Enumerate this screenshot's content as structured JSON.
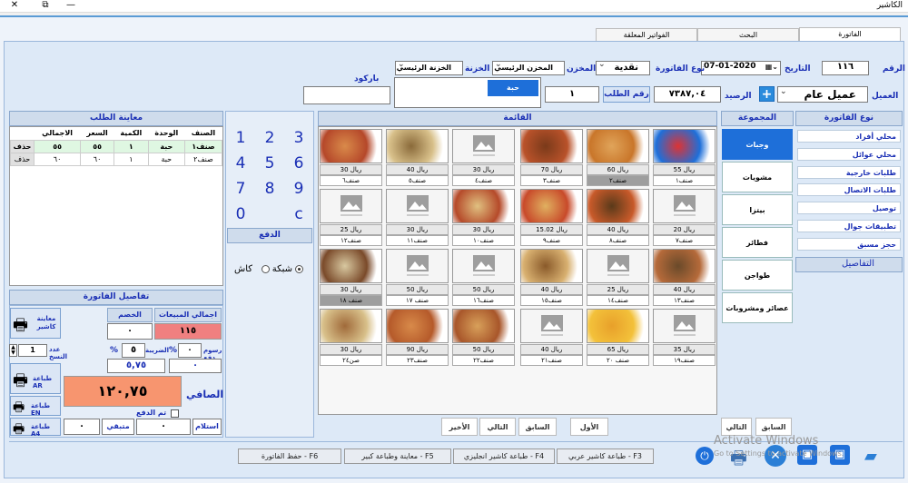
{
  "window": {
    "title": "الكاشير"
  },
  "tabs": [
    "الفاتورة",
    "البحث",
    "الفواتير المعلقة"
  ],
  "header": {
    "num_label": "الرقم",
    "num_value": "١١٦",
    "date_label": "التاريخ",
    "date_value": "07-01-2020",
    "invoice_type_label": "نوع الفاتورة",
    "invoice_type_value": "نقدية",
    "store_label": "المخزن",
    "store_value": "المخزن الرئيسي",
    "treasury_label": "الخزنة",
    "treasury_value": "الخزنة الرئيسي",
    "customer_label": "العميل",
    "customer_value": "عميل عام",
    "balance_label": "الرصيد",
    "balance_value": "٧٣٨٧,٠٤",
    "order_num_label": "رقم الطلب",
    "order_num_value": "١",
    "barcode_label": "باركود",
    "unit_popup_option": "حبة"
  },
  "invoice_types": {
    "header": "نوع الفاتورة",
    "items": [
      "محلي أفراد",
      "محلي عوائل",
      "طلبات خارجية",
      "طلبات الاتصال",
      "توصيل",
      "تطبيقات جوال",
      "حجز مسبق"
    ],
    "details_btn": "التفاصيل"
  },
  "groups": {
    "header": "المجموعة",
    "items": [
      "وجبات",
      "مشويات",
      "بيتزا",
      "فطائر",
      "طواجن",
      "عصائر ومشروبات"
    ],
    "prev": "السابق",
    "next": "التالي"
  },
  "menu": {
    "header": "القائمة",
    "items": [
      {
        "price": "ريال 55",
        "name": "صنف١"
      },
      {
        "price": "ريال 60",
        "name": "صنف٢"
      },
      {
        "price": "ريال 70",
        "name": "صنف٣"
      },
      {
        "price": "ريال 30",
        "name": "صنف٤"
      },
      {
        "price": "ريال 40",
        "name": "صنف٥"
      },
      {
        "price": "ريال 30",
        "name": "صنف٦"
      },
      {
        "price": "ريال 20",
        "name": "صنف٧"
      },
      {
        "price": "ريال 40",
        "name": "صنف٨"
      },
      {
        "price": "ريال 15.02",
        "name": "صنف٩"
      },
      {
        "price": "ريال 30",
        "name": "صنف١٠"
      },
      {
        "price": "ريال 30",
        "name": "صنف١١"
      },
      {
        "price": "ريال 25",
        "name": "صنف١٢"
      },
      {
        "price": "ريال 40",
        "name": "صنف١٣"
      },
      {
        "price": "ريال 25",
        "name": "صنف١٤"
      },
      {
        "price": "ريال 40",
        "name": "صنف١٥"
      },
      {
        "price": "ريال 50",
        "name": "صنف١٦"
      },
      {
        "price": "ريال 50",
        "name": "صنف ١٧"
      },
      {
        "price": "ريال 30",
        "name": "صنف ١٨"
      },
      {
        "price": "ريال 35",
        "name": "صنف١٩"
      },
      {
        "price": "ريال 65",
        "name": "صنف ٢٠"
      },
      {
        "price": "ريال 40",
        "name": "صنف٢١"
      },
      {
        "price": "ريال 50",
        "name": "صنف٢٢"
      },
      {
        "price": "ريال 90",
        "name": "صنف٢٣"
      },
      {
        "price": "ريال 30",
        "name": "صن٢٤"
      }
    ],
    "nav": [
      "الأول",
      "السابق",
      "التالي",
      "الأخير"
    ]
  },
  "keypad": {
    "keys": [
      "1",
      "2",
      "3",
      "4",
      "5",
      "6",
      "7",
      "8",
      "9",
      "0",
      "c"
    ],
    "pay_label": "الدفع",
    "cash": "كاش",
    "network": "شبكة"
  },
  "order_preview": {
    "header": "معاينة الطلب",
    "columns": [
      "الصنف",
      "الوحدة",
      "الكمية",
      "السعر",
      "الاجمالي"
    ],
    "rows": [
      {
        "item": "صنف١",
        "unit": "حبة",
        "qty": "١",
        "price": "٥٥",
        "total": "٥٥",
        "del": "حذف"
      },
      {
        "item": "صنف٢",
        "unit": "حبة",
        "qty": "١",
        "price": "٦٠",
        "total": "٦٠",
        "del": "حذف"
      }
    ]
  },
  "invoice_details": {
    "header": "تفاصيل الفاتورة",
    "sales_total_label": "اجمالي المبيعات",
    "sales_total_value": "١١٥",
    "discount_label": "الخصم",
    "discount_value": "٠",
    "service_fee_label": "رسوم دفع",
    "service_fee_value": "٠",
    "tax_label": "الضريبة",
    "tax_pct": "٥",
    "tax_value": "٥,٧٥",
    "fee_value2": "٠",
    "pct": "%",
    "net_label": "الصافي",
    "net_value": "١٢٠,٧٥",
    "paid_label": "تم الدفع",
    "received_label": "استلام",
    "received_value": "٠",
    "remaining_label": "متبقي",
    "remaining_value": "٠",
    "copies_label": "عدد النسخ",
    "copies_value": "1"
  },
  "side_buttons": {
    "preview": "معاينة كاشير",
    "print_ar": "طباعة AR",
    "print_en": "طباعة EN",
    "print_a4": "طباعة A4"
  },
  "fkeys": [
    "حفظ الفاتورة - F6",
    "معاينة وطباعة كبير - F5",
    "طباعة كاشير انجليزي - F4",
    "طباعة كاشير عربي - F3"
  ],
  "watermark": {
    "line1": "Activate Windows",
    "line2": "Go to Settings to activate Windows."
  }
}
